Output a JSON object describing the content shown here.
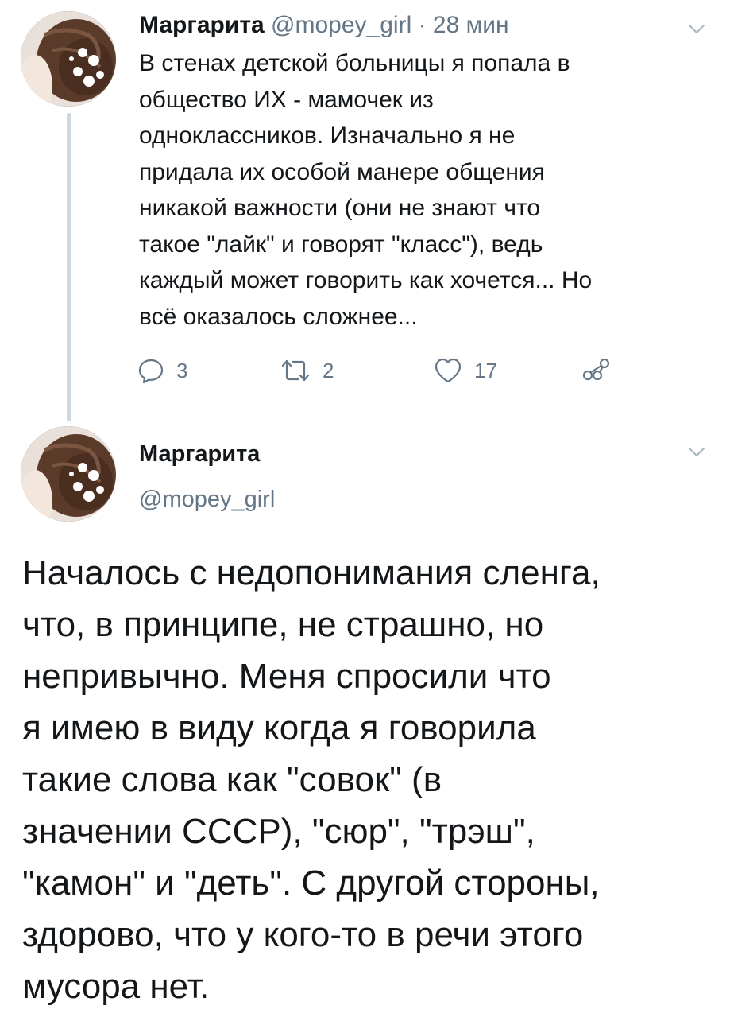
{
  "tweet1": {
    "display_name": "Маргарита",
    "handle": "@mopey_girl",
    "separator": "·",
    "time": "28 мин",
    "text_lines": [
      "В стенах детской больницы я попала в",
      "общество ИХ - мамочек из",
      "одноклассников. Изначально я не",
      "придала их особой манере общения",
      "никакой важности (они не знают что",
      "такое \"лайк\" и говорят \"класс\"), ведь",
      "каждый может говорить как хочется... Но",
      "всё оказалось сложнее..."
    ],
    "actions": {
      "reply_count": "3",
      "retweet_count": "2",
      "like_count": "17"
    }
  },
  "tweet2": {
    "display_name": "Маргарита",
    "handle": "@mopey_girl",
    "text_lines": [
      "Началось с недопонимания сленга,",
      "что, в принципе, не страшно, но",
      "непривычно. Меня спросили что",
      "я имею в виду когда я говорила",
      "такие слова как \"совок\" (в",
      "значении СССР), \"сюр\", \"трэш\",",
      "\"камон\" и \"деть\". С другой стороны,",
      "здорово, что у кого-то в речи этого",
      "мусора нет."
    ]
  },
  "icons": {
    "reply": "reply-icon",
    "retweet": "retweet-icon",
    "like": "heart-icon",
    "share": "share-icon",
    "menu": "chevron-down-icon"
  },
  "colors": {
    "text": "#14171a",
    "secondary": "#657786",
    "thread_line": "#cdd7df"
  }
}
